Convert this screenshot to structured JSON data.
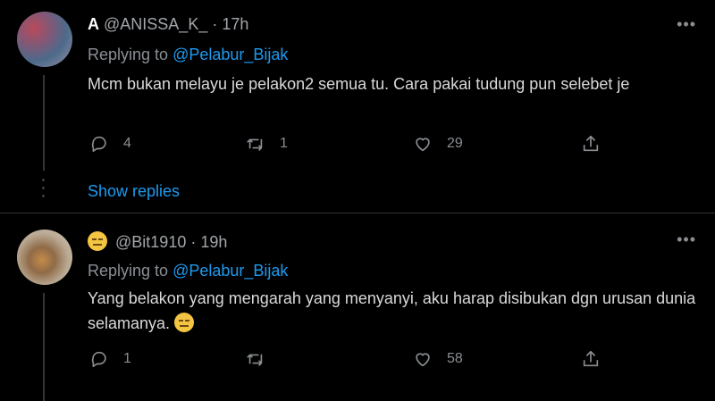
{
  "tweets": [
    {
      "display_name": "A",
      "handle": "@ANISSA_K_",
      "time": "17h",
      "replying_prefix": "Replying to",
      "replying_to": "@Pelabur_Bijak",
      "text": "Mcm bukan melayu je pelakon2 semua tu. Cara pakai tudung pun selebet je",
      "replies": "4",
      "retweets": "1",
      "likes": "29",
      "show_replies": "Show replies"
    },
    {
      "display_name": "😑",
      "handle": "@Bit1910",
      "time": "19h",
      "replying_prefix": "Replying to",
      "replying_to": "@Pelabur_Bijak",
      "text": "Yang belakon yang mengarah yang menyanyi, aku harap disibukan dgn urusan dunia selamanya.",
      "text_emoji": "😑",
      "replies": "1",
      "retweets": "",
      "likes": "58"
    }
  ],
  "icons": {
    "reply": "reply-icon",
    "retweet": "retweet-icon",
    "like": "heart-icon",
    "share": "share-icon",
    "more": "more-icon"
  },
  "colors": {
    "background": "#000000",
    "text": "#d9d9d9",
    "muted": "#8a8e92",
    "link": "#1d9bf0",
    "divider": "#2f3336"
  }
}
